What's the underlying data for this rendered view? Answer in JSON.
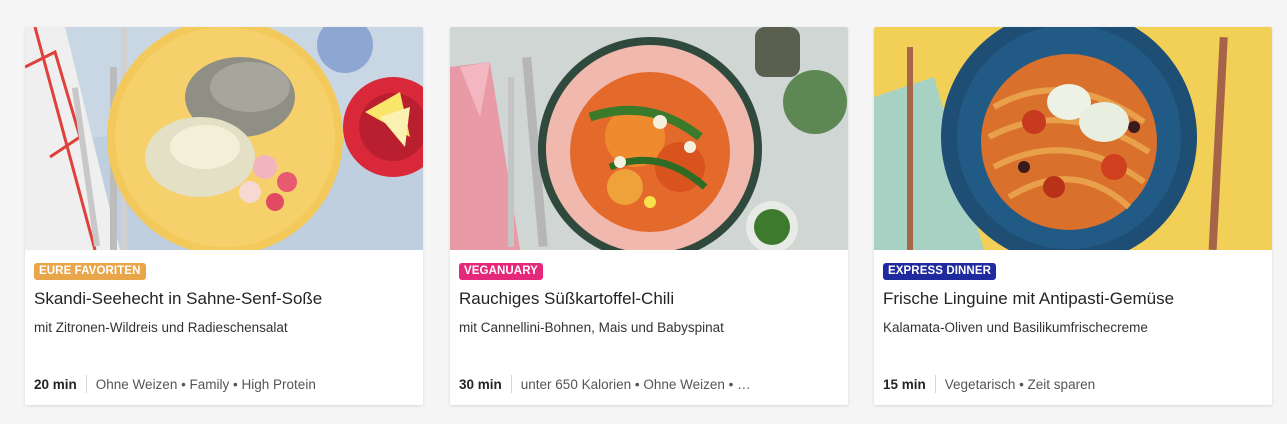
{
  "recipes": [
    {
      "tag": "EURE FAVORITEN",
      "tag_color": "#E8A54A",
      "title": "Skandi-Seehecht in Sahne-Senf-Soße",
      "subtitle": "mit Zitronen-Wildreis und Radieschensalat",
      "time": "20 min",
      "tags": "Ohne Weizen • Family • High Protein"
    },
    {
      "tag": "VEGANUARY",
      "tag_color": "#E4287A",
      "title": "Rauchiges Süßkartoffel-Chili",
      "subtitle": "mit Cannellini-Bohnen, Mais und Babyspinat",
      "time": "30 min",
      "tags": "unter 650 Kalorien • Ohne Weizen • …"
    },
    {
      "tag": "EXPRESS DINNER",
      "tag_color": "#1F2A9E",
      "title": "Frische Linguine mit Antipasti-Gemüse",
      "subtitle": "Kalamata-Oliven und Basilikumfrischecreme",
      "time": "15 min",
      "tags": "Vegetarisch • Zeit sparen"
    }
  ]
}
